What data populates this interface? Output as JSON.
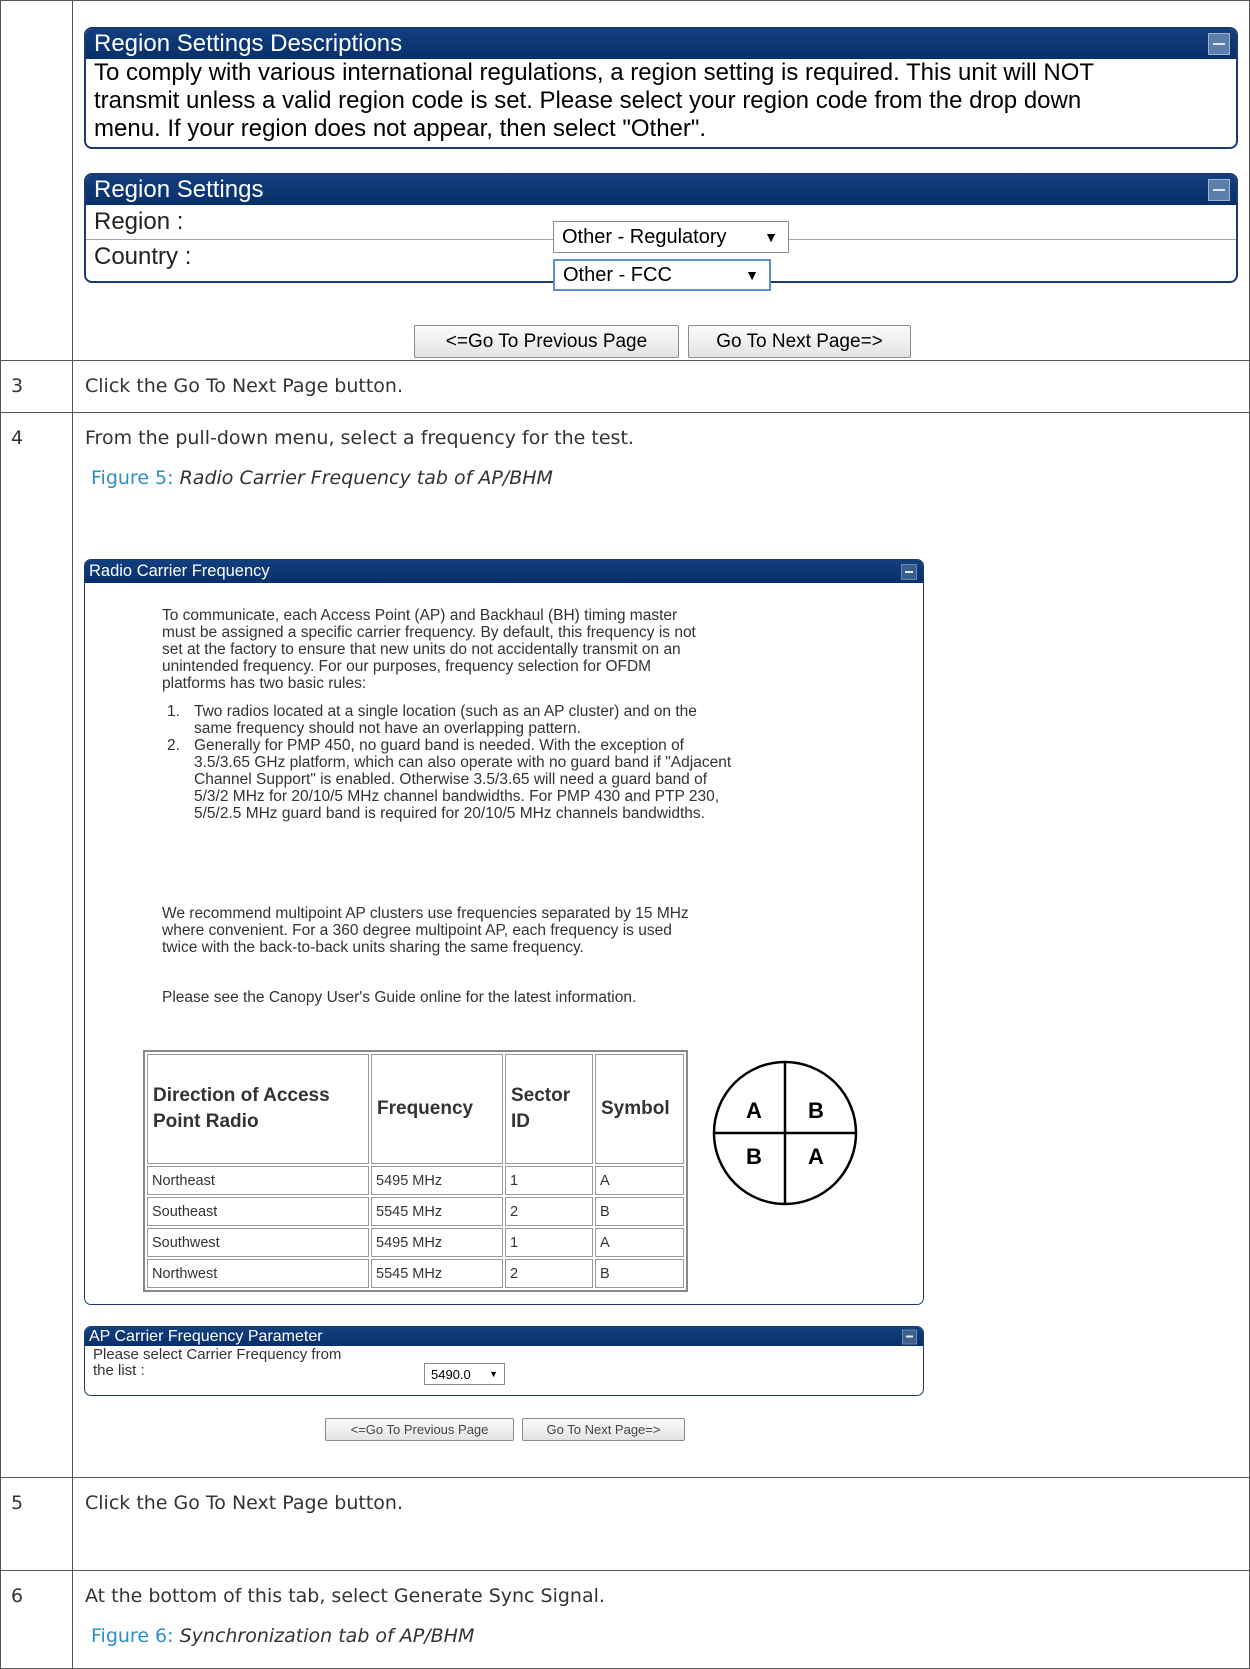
{
  "region_desc": {
    "title": "Region Settings Descriptions",
    "lines": [
      "To comply with various international regulations, a region setting is required. This unit will NOT",
      "transmit unless a valid region code is set. Please select your region code from the drop down",
      "menu. If your region does not appear, then select \"Other\"."
    ]
  },
  "region_settings": {
    "title": "Region Settings",
    "region_label": "Region :",
    "region_value": "Other - Regulatory",
    "country_label": "Country :",
    "country_value": "Other - FCC"
  },
  "nav": {
    "prev": "<=Go To Previous Page",
    "next": "Go To Next Page=>"
  },
  "steps": [
    {
      "num": "3",
      "text": "Click the Go To Next Page button."
    },
    {
      "num": "4",
      "text": "From the pull-down menu, select a frequency for the test.",
      "figure_label": "Figure 5:",
      "figure_title": "Radio Carrier Frequency tab of AP/BHM"
    },
    {
      "num": "5",
      "text": "Click the Go To Next Page button."
    },
    {
      "num": "6",
      "text": "At the bottom of this tab, select Generate Sync Signal.",
      "figure_label": "Figure 6:",
      "figure_title": "Synchronization tab of AP/BHM"
    }
  ],
  "rcf": {
    "title": "Radio Carrier Frequency",
    "para1": [
      "To communicate, each Access Point (AP) and Backhaul (BH) timing master",
      "must be assigned a specific carrier frequency. By default, this frequency is not",
      "set at the factory to ensure that new units do not accidentally transmit on an",
      "unintended frequency. For our purposes, frequency selection for OFDM",
      "platforms has two basic rules:"
    ],
    "rules": [
      {
        "n": "1.",
        "lines": [
          "Two radios located at a single location (such as an AP cluster) and on the",
          "same frequency should not have an overlapping pattern."
        ]
      },
      {
        "n": "2.",
        "lines": [
          "Generally for PMP 450, no guard band is needed. With the exception of",
          "3.5/3.65 GHz platform, which can also operate with no guard band if \"Adjacent",
          "Channel Support\" is enabled. Otherwise 3.5/3.65 will need a guard band of",
          "5/3/2 MHz for 20/10/5 MHz channel bandwidths. For PMP 430 and PTP 230,",
          "5/5/2.5 MHz guard band is required for 20/10/5 MHz channels bandwidths."
        ]
      }
    ],
    "para2": [
      "We recommend multipoint AP clusters use frequencies separated by 15 MHz",
      "where convenient. For a 360 degree multipoint AP, each frequency is used",
      "twice with the back-to-back units sharing the same frequency."
    ],
    "para3": "Please see the Canopy User's Guide online for the latest information.",
    "table": {
      "headers": [
        "Direction of Access Point Radio",
        "Frequency",
        "Sector ID",
        "Symbol"
      ],
      "rows": [
        [
          "Northeast",
          "5495 MHz",
          "1",
          "A"
        ],
        [
          "Southeast",
          "5545 MHz",
          "2",
          "B"
        ],
        [
          "Southwest",
          "5495 MHz",
          "1",
          "A"
        ],
        [
          "Northwest",
          "5545 MHz",
          "2",
          "B"
        ]
      ]
    },
    "diagram": {
      "top_left": "A",
      "top_right": "B",
      "bottom_left": "B",
      "bottom_right": "A"
    }
  },
  "ap_param": {
    "title": "AP Carrier Frequency Parameter",
    "label_line1": "Please select Carrier Frequency from",
    "label_line2": "the list :",
    "value": "5490.0"
  }
}
